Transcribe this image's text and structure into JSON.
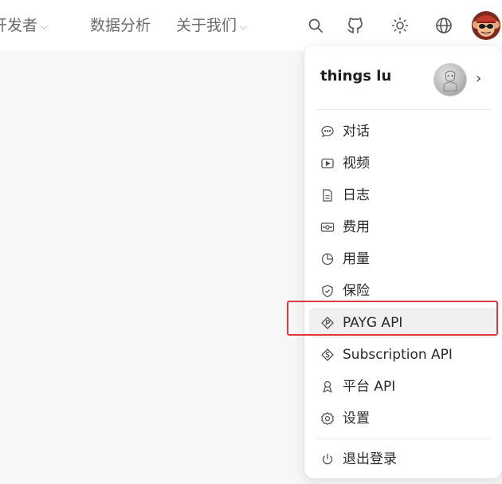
{
  "nav": {
    "links": [
      {
        "label": "开发者",
        "has_dropdown": true
      },
      {
        "label": "数据分析",
        "has_dropdown": false
      },
      {
        "label": "关于我们",
        "has_dropdown": true
      }
    ],
    "icons": [
      "search-icon",
      "github-icon",
      "sun-icon",
      "globe-icon"
    ],
    "avatar": "monkey-avatar"
  },
  "dropdown": {
    "username": "things lu",
    "items": [
      {
        "label": "对话",
        "icon": "chat-icon"
      },
      {
        "label": "视频",
        "icon": "video-icon"
      },
      {
        "label": "日志",
        "icon": "document-icon"
      },
      {
        "label": "费用",
        "icon": "money-icon"
      },
      {
        "label": "用量",
        "icon": "pie-chart-icon"
      },
      {
        "label": "保险",
        "icon": "shield-icon"
      },
      {
        "label": "PAYG API",
        "icon": "payg-icon",
        "active": true
      },
      {
        "label": "Subscription API",
        "icon": "subscription-icon"
      },
      {
        "label": "平台 API",
        "icon": "platform-icon"
      },
      {
        "label": "设置",
        "icon": "gear-icon"
      }
    ],
    "logout": {
      "label": "退出登录",
      "icon": "power-icon"
    }
  },
  "colors": {
    "highlight": "#e0393b",
    "active_bg": "#f0f0f0"
  }
}
